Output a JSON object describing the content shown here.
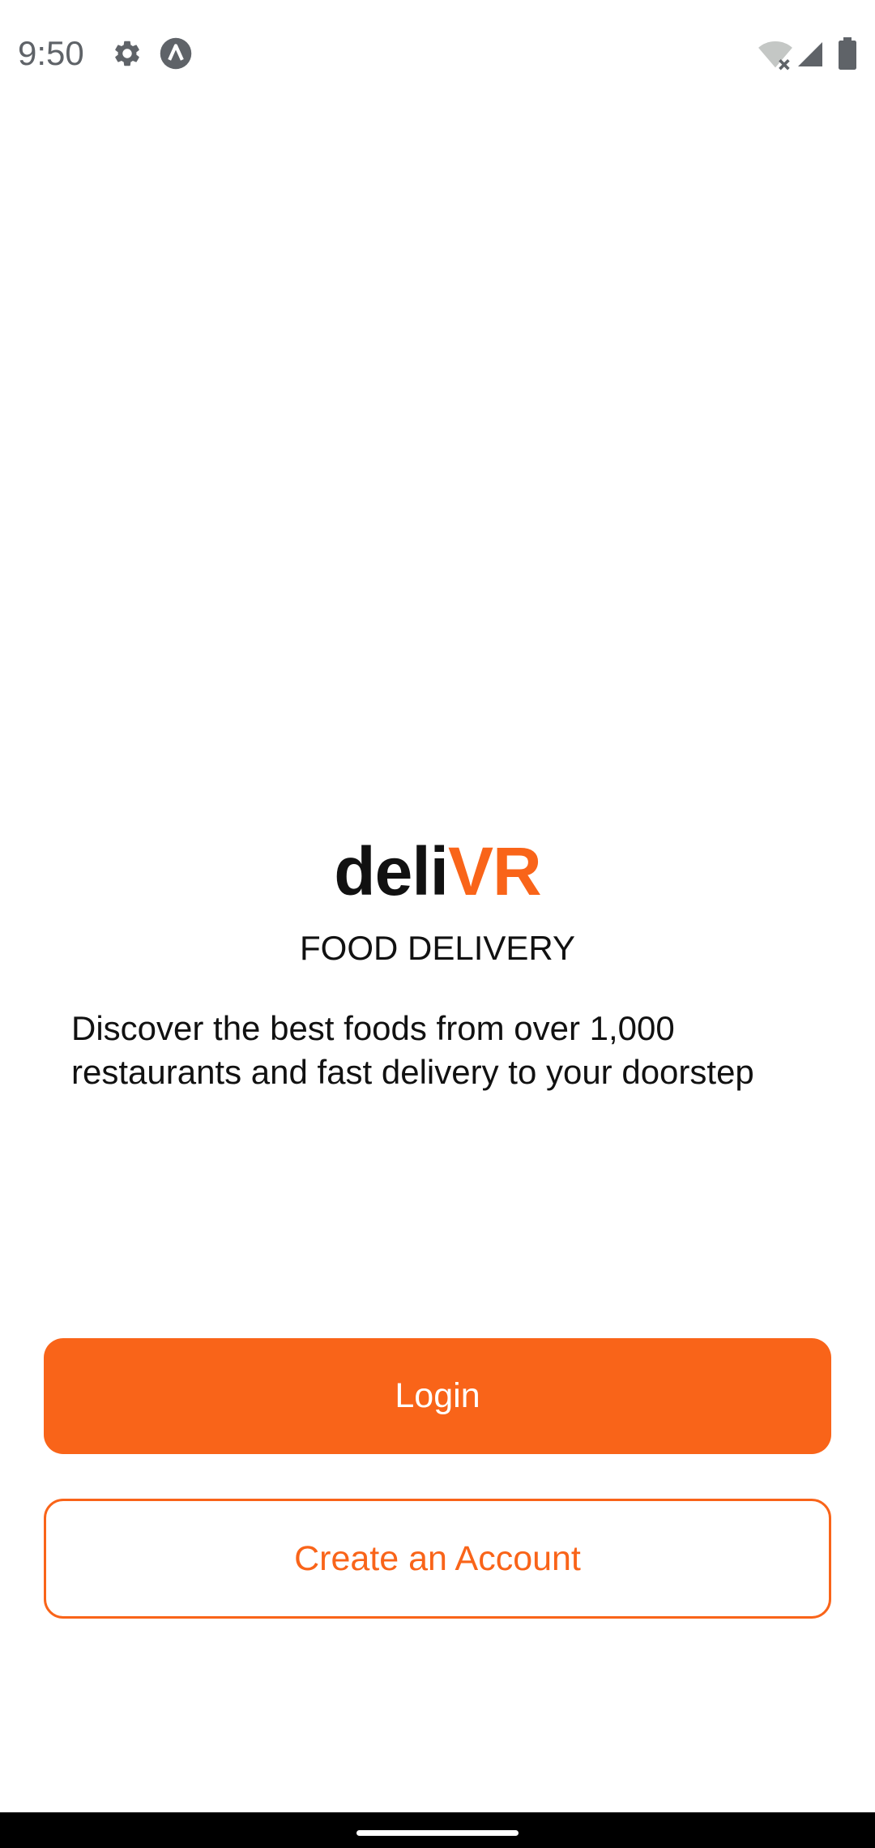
{
  "status_bar": {
    "time": "9:50",
    "icons": [
      "settings-gear-icon",
      "app-notification-icon",
      "wifi-off-icon",
      "cell-signal-icon",
      "battery-icon"
    ]
  },
  "app": {
    "logo_prefix": "deli",
    "logo_accent": "VR",
    "tagline": "FOOD DELIVERY",
    "description": "Discover the best foods from over 1,000 restaurants and fast delivery to your doorstep"
  },
  "actions": {
    "login_label": "Login",
    "create_account_label": "Create an Account"
  },
  "colors": {
    "accent": "#f96419",
    "text": "#111111",
    "background": "#ffffff",
    "status_icon": "#5f6368"
  }
}
